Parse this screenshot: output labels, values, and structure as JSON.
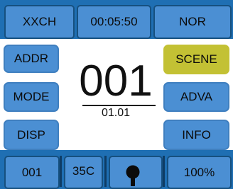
{
  "status_bar": {
    "channel": "XXCH",
    "timer": "00:05:50",
    "mode_status": "NOR"
  },
  "left_menu": {
    "addr": "ADDR",
    "mode": "MODE",
    "disp": "DISP"
  },
  "right_menu": {
    "scene": "SCENE",
    "adva": "ADVA",
    "info": "INFO"
  },
  "display": {
    "address_value": "001",
    "sub_value": "01.01"
  },
  "bottom_bar": {
    "field_1": "001",
    "temperature": "35C",
    "lock_icon": "keyhole-icon",
    "level": "100%"
  },
  "colors": {
    "bar_blue": "#1f6fb3",
    "button_blue": "#4b8fd3",
    "active_olive": "#c3c134"
  }
}
